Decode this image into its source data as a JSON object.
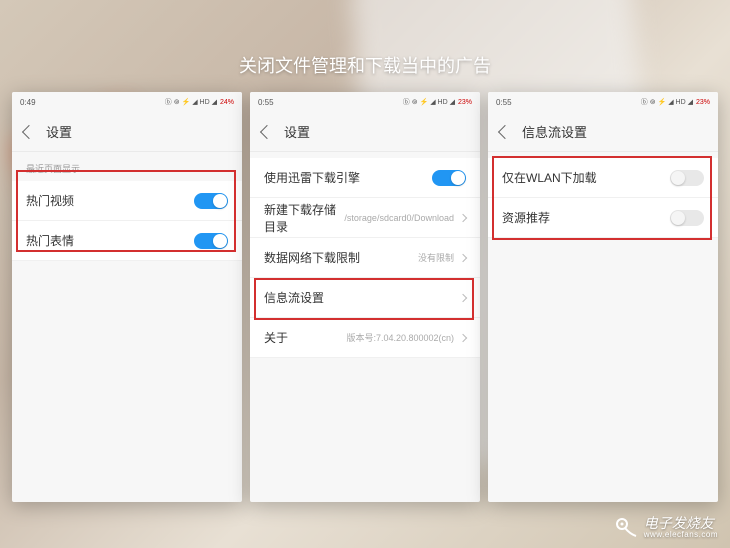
{
  "title": "关闭文件管理和下载当中的广告",
  "phones": [
    {
      "time": "0:49",
      "status_icons": "ⓑ ⊚ ⚡ ◢ HD ◢",
      "battery": "24%",
      "header": "设置",
      "section_label": "最近页面显示",
      "rows": [
        {
          "label": "热门视频",
          "type": "toggle",
          "on": true
        },
        {
          "label": "热门表情",
          "type": "toggle",
          "on": true
        }
      ]
    },
    {
      "time": "0:55",
      "status_icons": "ⓑ ⊚ ⚡ ◢ HD ◢",
      "battery": "23%",
      "header": "设置",
      "section_label": "",
      "rows": [
        {
          "label": "使用迅雷下载引擎",
          "type": "toggle",
          "on": true
        },
        {
          "label": "新建下载存储目录",
          "type": "nav",
          "value": "/storage/sdcard0/Download"
        },
        {
          "label": "数据网络下载限制",
          "type": "nav",
          "value": "没有限制"
        },
        {
          "label": "信息流设置",
          "type": "nav",
          "value": ""
        },
        {
          "label": "关于",
          "type": "nav",
          "value": "版本号:7.04.20.800002(cn)"
        }
      ]
    },
    {
      "time": "0:55",
      "status_icons": "ⓑ ⊚ ⚡ ◢ HD ◢",
      "battery": "23%",
      "header": "信息流设置",
      "section_label": "",
      "rows": [
        {
          "label": "仅在WLAN下加载",
          "type": "toggle",
          "on": false
        },
        {
          "label": "资源推荐",
          "type": "toggle",
          "on": false
        }
      ]
    }
  ],
  "watermark": {
    "name": "电子发烧友",
    "url": "www.elecfans.com"
  }
}
